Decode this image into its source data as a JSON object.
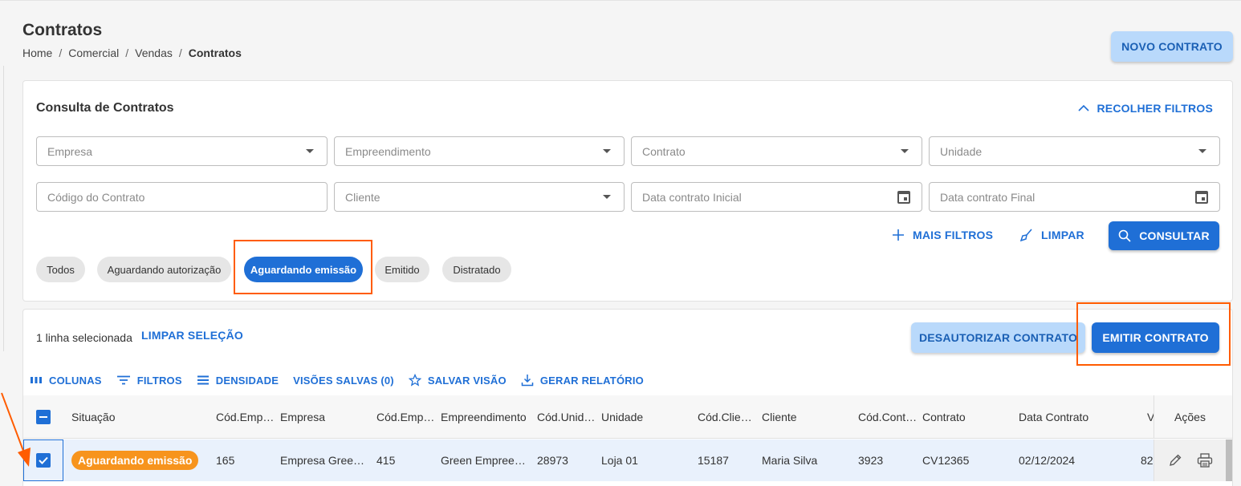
{
  "page": {
    "title": "Contratos"
  },
  "breadcrumb": [
    "Home",
    "Comercial",
    "Vendas",
    "Contratos"
  ],
  "header": {
    "novo_contrato": "NOVO CONTRATO"
  },
  "filters": {
    "title": "Consulta de Contratos",
    "recolher": "RECOLHER FILTROS",
    "row1": [
      "Empresa",
      "Empreendimento",
      "Contrato",
      "Unidade"
    ],
    "codigo": "Código do Contrato",
    "cliente": "Cliente",
    "data_inicial": "Data contrato Inicial",
    "data_final": "Data contrato Final",
    "mais_filtros": "MAIS FILTROS",
    "limpar": "LIMPAR",
    "consultar": "CONSULTAR",
    "chips": [
      "Todos",
      "Aguardando autorização",
      "Aguardando emissão",
      "Emitido",
      "Distratado"
    ],
    "active_chip": "Aguardando emissão"
  },
  "grid": {
    "selection_text": "1 linha selecionada",
    "limpar_selecao": "LIMPAR SELEÇÃO",
    "desautorizar": "DESAUTORIZAR CONTRATO",
    "emitir": "EMITIR CONTRATO",
    "toolbar": {
      "colunas": "COLUNAS",
      "filtros": "FILTROS",
      "densidade": "DENSIDADE",
      "visoes": "VISÕES SALVAS (0)",
      "salvar": "SALVAR VISÃO",
      "relatorio": "GERAR RELATÓRIO"
    },
    "columns": [
      "Situação",
      "Cód.Emp…",
      "Empresa",
      "Cód.Emp…",
      "Empreendimento",
      "Cód.Unid…",
      "Unidade",
      "Cód.Clie…",
      "Cliente",
      "Cód.Cont…",
      "Contrato",
      "Data Contrato",
      "V",
      "Ações"
    ],
    "row": {
      "situacao": "Aguardando emissão",
      "cod_empresa": "165",
      "empresa": "Empresa Gree…",
      "cod_empreendimento": "415",
      "empreendimento": "Green Empree…",
      "cod_unidade": "28973",
      "unidade": "Loja 01",
      "cod_cliente": "15187",
      "cliente": "Maria Silva",
      "cod_contrato": "3923",
      "contrato": "CV12365",
      "data_contrato": "02/12/2024",
      "valor": "82"
    }
  },
  "colors": {
    "primary": "#1f6fd6",
    "light_button": "#b9d9fb",
    "badge": "#f7941d",
    "highlight": "#ff5c00"
  }
}
